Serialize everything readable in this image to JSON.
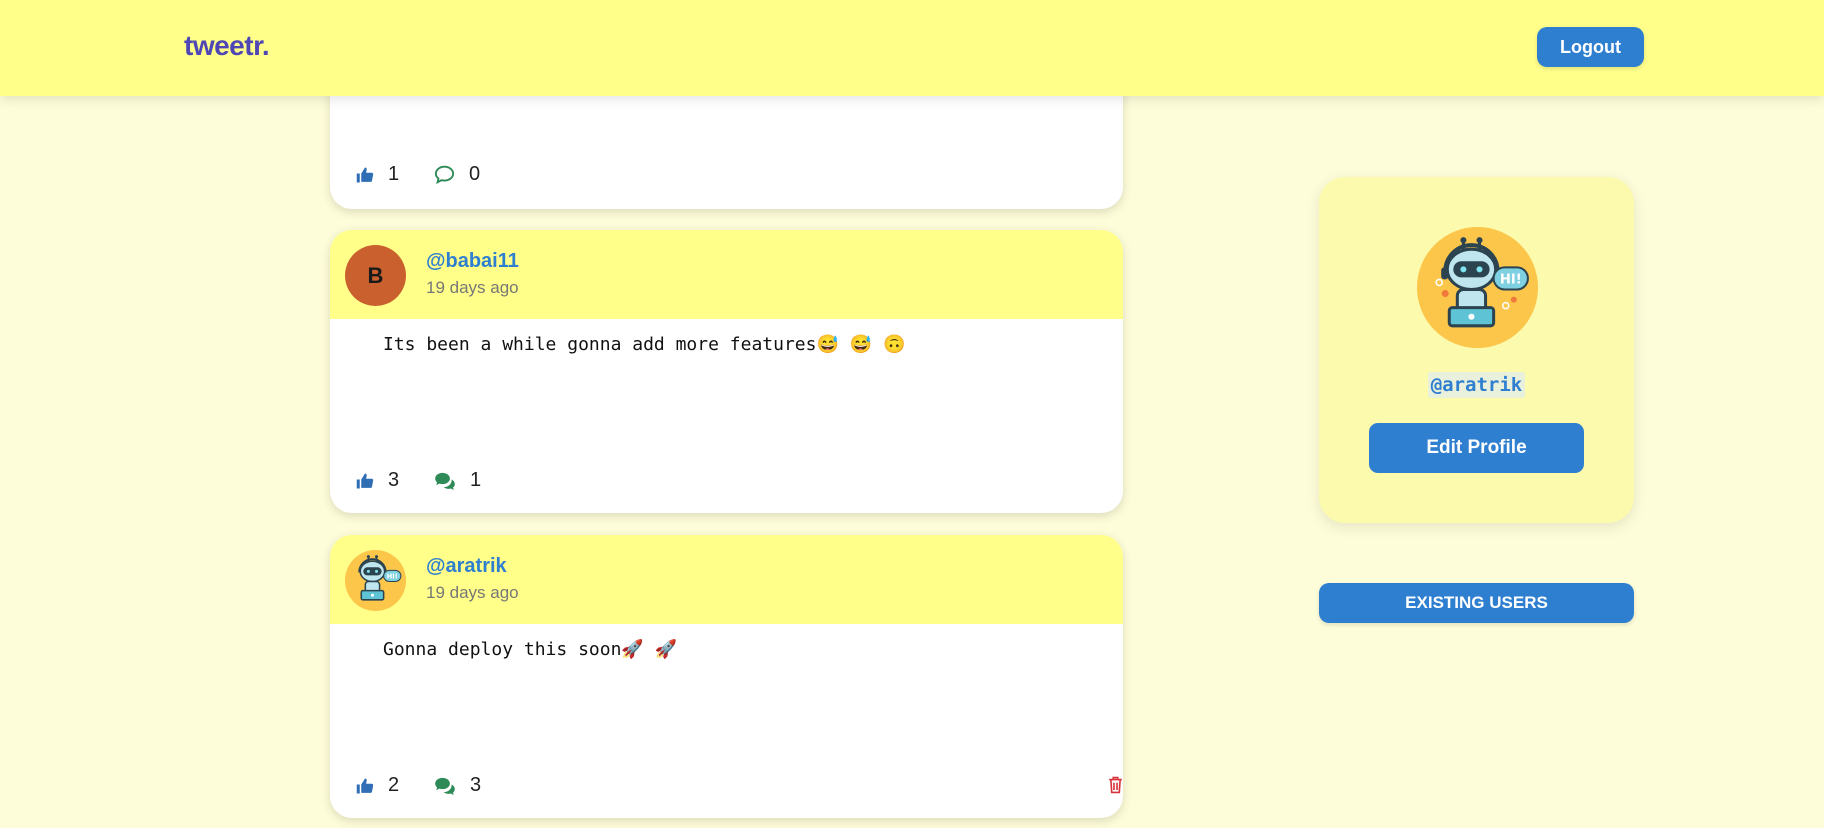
{
  "app": {
    "brand": "tweetr."
  },
  "header": {
    "logout_label": "Logout"
  },
  "colors": {
    "nav_bg": "#ffff8a",
    "page_bg": "#fefdd9",
    "accent_blue": "#2f7fd1",
    "brand_purple": "#4f46b5",
    "like_icon": "#2f6db5",
    "comment_icon": "#2e8b57",
    "delete_icon": "#d9343b"
  },
  "feed": {
    "posts": [
      {
        "likes": "1",
        "comments": "0",
        "comment_icon": "comment-outline-icon"
      },
      {
        "avatar_letter": "B",
        "avatar_color": "#c9602e",
        "handle": "@babai11",
        "time": "19 days ago",
        "content": "Its been a while gonna add more features😅 😅 🙃",
        "likes": "3",
        "comments": "1",
        "comment_icon": "comments-icon"
      },
      {
        "avatar_icon": "robot-avatar-icon",
        "handle": "@aratrik",
        "time": "19 days ago",
        "content": "Gonna deploy this soon🚀 🚀",
        "likes": "2",
        "comments": "3",
        "comment_icon": "comments-icon",
        "delete_icon": "trash-icon"
      }
    ]
  },
  "sidebar": {
    "profile": {
      "avatar_icon": "robot-avatar-icon",
      "handle": "@aratrik",
      "edit_label": "Edit Profile"
    },
    "existing_users_label": "EXISTING USERS"
  }
}
